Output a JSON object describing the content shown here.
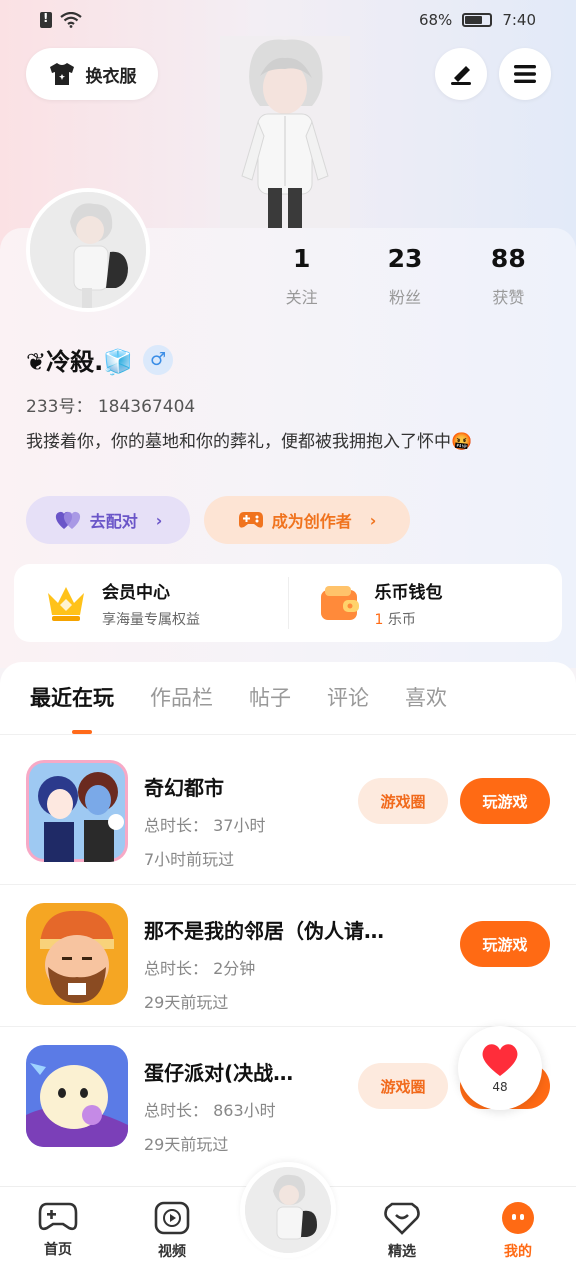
{
  "status_bar": {
    "battery_text": "68%",
    "battery_level": 0.68,
    "time": "7:40"
  },
  "header": {
    "wardrobe_label": "换衣服",
    "edit_icon": "pen-icon",
    "menu_icon": "hamburger-menu-icon"
  },
  "profile": {
    "stats": [
      {
        "value": "1",
        "label": "关注"
      },
      {
        "value": "23",
        "label": "粉丝"
      },
      {
        "value": "88",
        "label": "获赞"
      }
    ],
    "nickname": "❦冷殺.🧊",
    "gender_symbol": "♂",
    "uid": "233号： 184367404",
    "bio": "我搂着你，你的墓地和你的葬礼，便都被我拥抱入了怀中🤬",
    "match_label": "去配对",
    "creator_label": "成为创作者"
  },
  "vip": {
    "member_title": "会员中心",
    "member_sub": "享海量专属权益",
    "wallet_title": "乐币钱包",
    "wallet_count": "1",
    "wallet_unit": " 乐币"
  },
  "tabs": [
    "最近在玩",
    "作品栏",
    "帖子",
    "评论",
    "喜欢"
  ],
  "games": [
    {
      "title": "奇幻都市",
      "time": "总时长： 37小时",
      "last": "7小时前玩过",
      "circle_label": "游戏圈",
      "play_label": "玩游戏"
    },
    {
      "title": "那不是我的邻居（伪人请…",
      "time": "总时长： 2分钟",
      "last": "29天前玩过",
      "play_label": "玩游戏"
    },
    {
      "title": "蛋仔派对(决战…",
      "time": "总时长： 863小时",
      "last": "29天前玩过",
      "circle_label": "游戏圈",
      "play_label": "玩游戏"
    }
  ],
  "floating_like": {
    "count": "48"
  },
  "bottom_nav": [
    {
      "label": "首页",
      "icon": "gamepad-icon"
    },
    {
      "label": "视频",
      "icon": "video-play-icon"
    },
    {
      "label": "精选",
      "icon": "heart-badge-icon"
    },
    {
      "label": "我的",
      "icon": "profile-face-icon"
    }
  ],
  "colors": {
    "accent": "#ff6a14",
    "match_purple": "#6a55c8"
  }
}
